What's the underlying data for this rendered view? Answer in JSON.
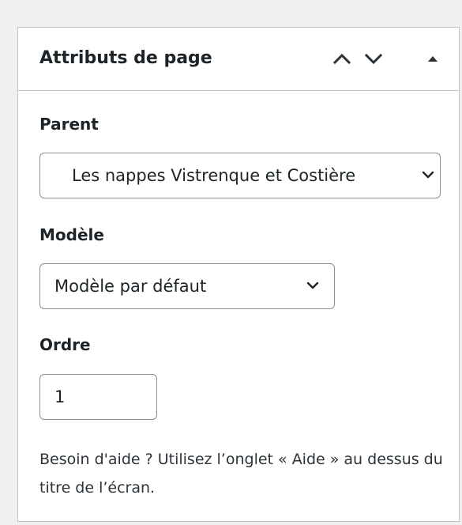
{
  "panel": {
    "title": "Attributs de page",
    "header_icons": {
      "move_up": "chevron-up-icon",
      "move_down": "chevron-down-icon",
      "toggle": "triangle-up-icon"
    }
  },
  "fields": {
    "parent": {
      "label": "Parent",
      "value": "Les nappes Vistrenque et Costière"
    },
    "template": {
      "label": "Modèle",
      "value": "Modèle par défaut"
    },
    "order": {
      "label": "Ordre",
      "value": "1"
    }
  },
  "help": {
    "text": "Besoin d'aide ? Utilisez l’onglet « Aide » au dessus du titre de l’écran."
  },
  "colors": {
    "background": "#f0f0f1",
    "panel": "#ffffff",
    "border": "#c3c4c7",
    "text": "#1d2327"
  }
}
